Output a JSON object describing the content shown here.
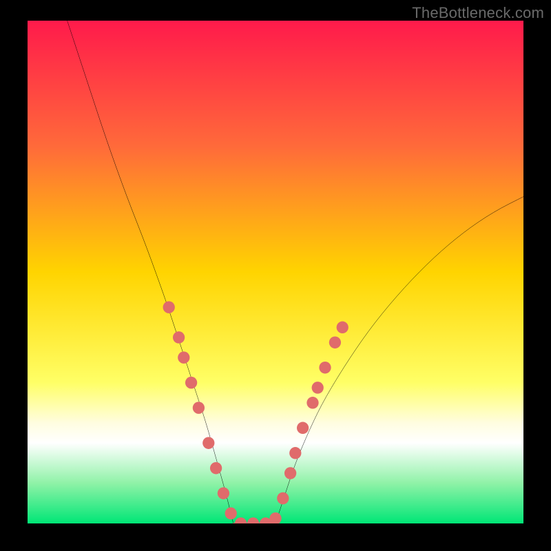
{
  "watermark": "TheBottleneck.com",
  "chart_data": {
    "type": "line",
    "title": "",
    "xlabel": "",
    "ylabel": "",
    "xlim": [
      0,
      100
    ],
    "ylim": [
      0,
      100
    ],
    "grid": false,
    "legend": false,
    "background_gradient_stops": [
      {
        "pct": 0,
        "color": "#ff1a4b"
      },
      {
        "pct": 25,
        "color": "#ff6a3a"
      },
      {
        "pct": 50,
        "color": "#ffd400"
      },
      {
        "pct": 72,
        "color": "#ffff66"
      },
      {
        "pct": 80,
        "color": "#fffde0"
      },
      {
        "pct": 84,
        "color": "#ffffff"
      },
      {
        "pct": 92,
        "color": "#8ff2a7"
      },
      {
        "pct": 100,
        "color": "#00e676"
      }
    ],
    "series": [
      {
        "name": "left-branch",
        "color": "#000000",
        "x": [
          8,
          12,
          16,
          20,
          24,
          28,
          30,
          32,
          34,
          36,
          38,
          40,
          41.5
        ],
        "y": [
          100,
          88,
          76,
          65,
          55,
          44,
          38,
          32,
          26,
          20,
          13,
          6,
          0
        ]
      },
      {
        "name": "right-branch",
        "color": "#000000",
        "x": [
          50,
          52,
          54,
          57,
          60,
          65,
          70,
          76,
          82,
          88,
          94,
          100
        ],
        "y": [
          0,
          6,
          12,
          19,
          25,
          33,
          40,
          47,
          53,
          58,
          62,
          65
        ]
      },
      {
        "name": "valley-floor",
        "color": "#e06b6b",
        "x": [
          41.5,
          43,
          45,
          47,
          49,
          50
        ],
        "y": [
          0,
          0,
          0,
          0,
          0,
          0
        ]
      }
    ],
    "marker_points": {
      "color": "#e06b6b",
      "radius_pct": 1.2,
      "points": [
        {
          "x": 28.5,
          "y": 43
        },
        {
          "x": 30.5,
          "y": 37
        },
        {
          "x": 31.5,
          "y": 33
        },
        {
          "x": 33.0,
          "y": 28
        },
        {
          "x": 34.5,
          "y": 23
        },
        {
          "x": 36.5,
          "y": 16
        },
        {
          "x": 38.0,
          "y": 11
        },
        {
          "x": 39.5,
          "y": 6
        },
        {
          "x": 41.0,
          "y": 2
        },
        {
          "x": 43.0,
          "y": 0
        },
        {
          "x": 45.5,
          "y": 0
        },
        {
          "x": 48.0,
          "y": 0
        },
        {
          "x": 50.0,
          "y": 1
        },
        {
          "x": 51.5,
          "y": 5
        },
        {
          "x": 53.0,
          "y": 10
        },
        {
          "x": 54.0,
          "y": 14
        },
        {
          "x": 55.5,
          "y": 19
        },
        {
          "x": 57.5,
          "y": 24
        },
        {
          "x": 58.5,
          "y": 27
        },
        {
          "x": 60.0,
          "y": 31
        },
        {
          "x": 62.0,
          "y": 36
        },
        {
          "x": 63.5,
          "y": 39
        }
      ]
    }
  }
}
